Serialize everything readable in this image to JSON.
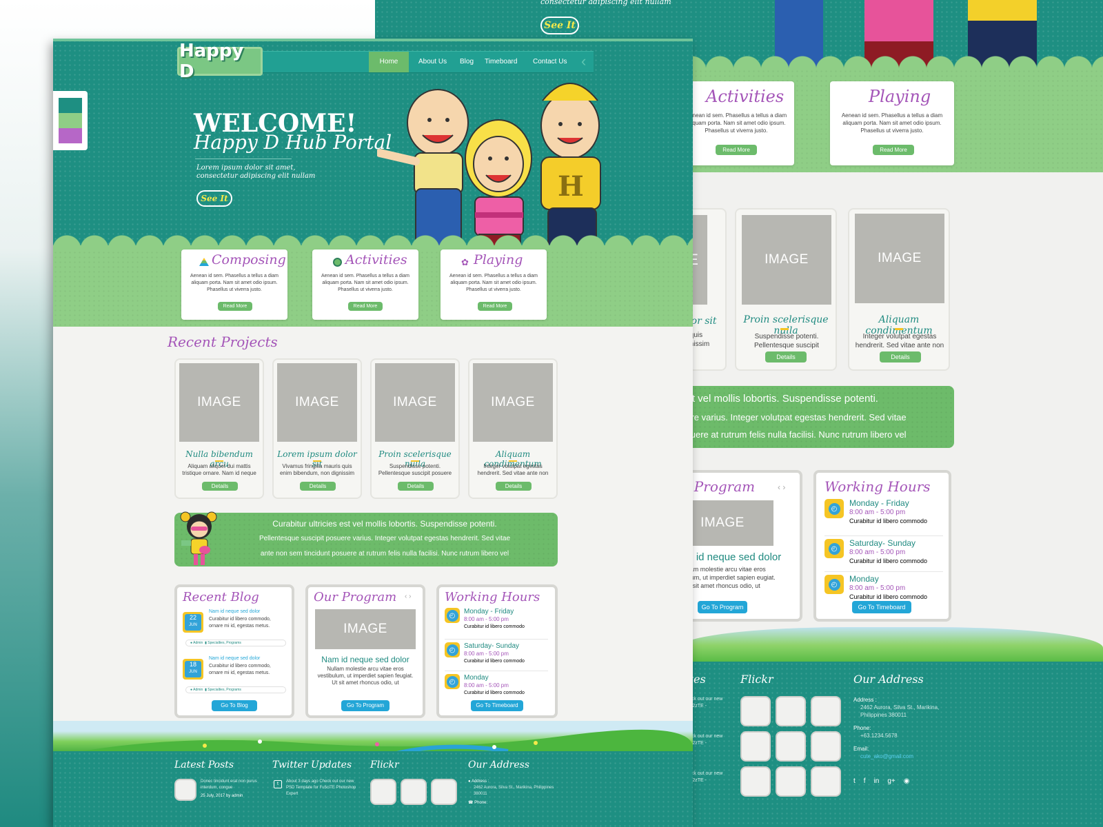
{
  "colors": {
    "teal": "#1e8f82",
    "green": "#8fce86",
    "purple": "#a455b8",
    "blue": "#23a6d7",
    "yellow": "#f5c524"
  },
  "hero_back": {
    "see_it": "See It",
    "subtext": "consectetur adipiscing elit nullam"
  },
  "site": {
    "logo": "Happy D"
  },
  "nav": {
    "items": [
      "Home",
      "About Us",
      "Blog",
      "Timeboard",
      "Contact Us"
    ]
  },
  "hero": {
    "welcome": "WELCOME!",
    "title": "Happy D Hub Portal",
    "sub1": "Lorem ipsum dolor sit amet,",
    "sub2": "consectetur adipiscing elit nullam",
    "cta": "See It"
  },
  "features": [
    {
      "title": "Composing",
      "icon": "pyramid-icon",
      "text": "Aenean id sem. Phasellus a tellus a diam aliquam porta. Nam sit amet odio ipsum. Phasellus ut viverra justo.",
      "btn": "Read More"
    },
    {
      "title": "Activities",
      "icon": "ball-icon",
      "text": "Aenean id sem. Phasellus a tellus a diam aliquam porta. Nam sit amet odio ipsum. Phasellus ut viverra justo.",
      "btn": "Read More"
    },
    {
      "title": "Playing",
      "icon": "toys-icon",
      "text": "Aenean id sem. Phasellus a tellus a diam aliquam porta. Nam sit amet odio ipsum. Phasellus ut viverra justo.",
      "btn": "Read More"
    }
  ],
  "projects": {
    "heading": "Recent Projects",
    "items": [
      {
        "img": "IMAGE",
        "title": "Nulla bibendum arcu",
        "text": "Aliquam aliquet dui mattis tristique ornare. Nam id neque",
        "btn": "Details"
      },
      {
        "img": "IMAGE",
        "title": "Lorem ipsum dolor sit",
        "text": "Vivamus fringilla mauris quis enim bibendum, non dignissim",
        "btn": "Details"
      },
      {
        "img": "IMAGE",
        "title": "Proin scelerisque nulla",
        "text": "Suspendisse potenti. Pellentesque suscipit posuere",
        "btn": "Details"
      },
      {
        "img": "IMAGE",
        "title": "Aliquam condimentum",
        "text": "Integer volutpat egestas hendrerit. Sed vitae ante non",
        "btn": "Details"
      }
    ]
  },
  "banner": {
    "line1": "Curabitur ultricies est vel mollis lobortis. Suspendisse potenti.",
    "line2": "Pellentesque suscipit posuere varius. Integer volutpat egestas hendrerit. Sed vitae",
    "line3": "ante non sem tincidunt posuere at rutrum felis nulla facilisi. Nunc rutrum libero vel"
  },
  "blog": {
    "heading": "Recent Blog",
    "posts": [
      {
        "day": "22",
        "month": "JUN",
        "title": "Nam id neque sed dolor",
        "text": "Curabitur id libero commodo, ornare mi id, egestas metus.",
        "author": "Admin",
        "tags": "Specialties, Programs"
      },
      {
        "day": "18",
        "month": "JUN",
        "title": "Nam id neque sed dolor",
        "text": "Curabitur id libero commodo, ornare mi id, egestas metus.",
        "author": "Admin",
        "tags": "Specialties, Programs"
      }
    ],
    "btn": "Go To Blog"
  },
  "program": {
    "heading": "Our Program",
    "arrows": "<>",
    "img": "IMAGE",
    "title": "Nam id neque sed dolor",
    "text": "Nullam molestie arcu vitae eros vestibulum, ut imperdiet sapien feugiat. Ut sit amet rhoncus odio, ut",
    "btn": "Go To Program"
  },
  "hours": {
    "heading": "Working Hours",
    "items": [
      {
        "day": "Monday - Friday",
        "time": "8:00 am - 5:00 pm",
        "note": "Curabitur id libero commodo"
      },
      {
        "day": "Saturday- Sunday",
        "time": "8:00 am - 5:00 pm",
        "note": "Curabitur id libero commodo"
      },
      {
        "day": "Monday",
        "time": "8:00 am - 5:00 pm",
        "note": "Curabitur id libero commodo"
      }
    ],
    "btn": "Go To Timeboard"
  },
  "footer": {
    "latest": "Latest Posts",
    "twitter": "Twitter Updates",
    "flickr": "Flickr",
    "address_h": "Our Address",
    "post_text": "Donec tincidunt erat non purus interdum, congue",
    "post_date": "25 July, 2017 by admin",
    "tweet": "About 3 days ago Check out our new PSD Template for Fu5ciTE Photoshop Expert",
    "address_label": "Address :",
    "address": "2462 Aurora, Silva St., Marikina, Philippines 380011",
    "phone_label": "Phone:",
    "phone": "+63.1234.5678",
    "email_label": "Email:",
    "email": "cute_ako@gmail.com"
  },
  "back": {
    "activities": "Activities",
    "playing": "Playing",
    "feat_text": "Aenean id sem. Phasellus a tellus a diam aliquam porta. Nam sit amet odio ipsum. Phasellus ut viverra justo.",
    "read_more": "Read More",
    "proj_frag_title": "a dolor sit",
    "proj_frag_text": "mauris quis non dignissim",
    "proj2": {
      "img": "IMAGE",
      "title": "Proin scelerisque nulla",
      "text": "Suspendisse potenti. Pellentesque suscipit posuere",
      "btn": "Details"
    },
    "proj3": {
      "img": "IMAGE",
      "title": "Aliquam condimentum",
      "text": "Integer volutpat egestas hendrerit. Sed vitae ante non",
      "btn": "Details"
    },
    "proj1_img": "GE",
    "banner1": "est vel mollis lobortis. Suspendisse potenti.",
    "banner2": "uere varius. Integer volutpat egestas hendrerit. Sed vitae",
    "banner3": "osuere at rutrum felis nulla facilisi. Nunc rutrum libero vel",
    "program_h": "ur Program",
    "program_title": "Nam id neque sed dolor",
    "program_text": "Nullam molestie arcu vitae eros vestibulum, ut imperdiet sapien eugiat. Ut sit amet rhoncus odio, ut",
    "footer_frag": "ates",
    "footer_text": "Check out our new",
    "footer_code": "fyrW2zTE -"
  }
}
